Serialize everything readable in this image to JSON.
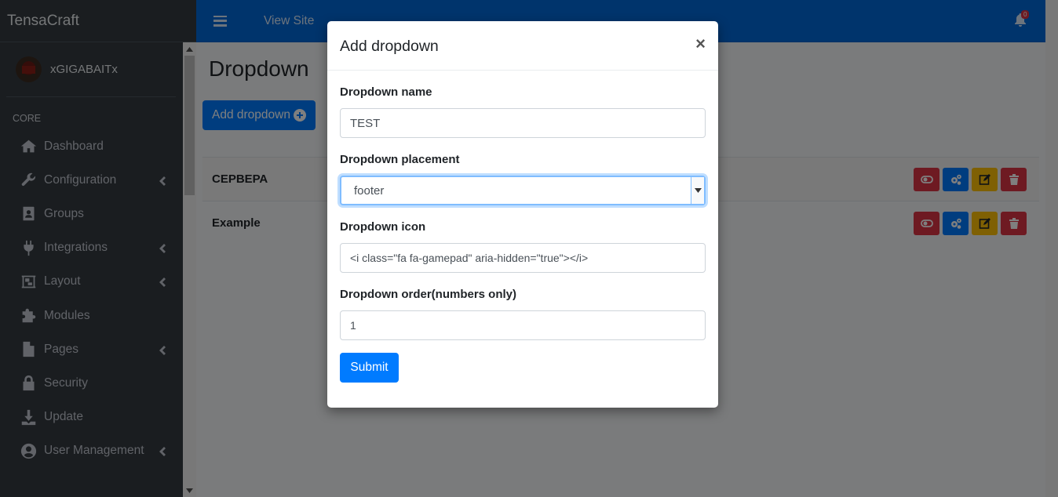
{
  "sidebar": {
    "brand": "TensaCraft",
    "user_name": "xGIGABAITx",
    "nav_header": "CORE",
    "items": [
      {
        "label": "Dashboard"
      },
      {
        "label": "Configuration"
      },
      {
        "label": "Groups"
      },
      {
        "label": "Integrations"
      },
      {
        "label": "Layout"
      },
      {
        "label": "Modules"
      },
      {
        "label": "Pages"
      },
      {
        "label": "Security"
      },
      {
        "label": "Update"
      },
      {
        "label": "User Management"
      }
    ]
  },
  "topnav": {
    "view_site": "View Site",
    "notification_count": "0"
  },
  "main": {
    "title": "Dropdown",
    "add_button": "Add dropdown",
    "rows": [
      {
        "name": "СЕРВЕРА"
      },
      {
        "name": "Example"
      }
    ]
  },
  "modal": {
    "title": "Add dropdown",
    "close": "×",
    "name_label": "Dropdown name",
    "name_value": "TEST",
    "placement_label": "Dropdown placement",
    "placement_value": "footer",
    "icon_label": "Dropdown icon",
    "icon_value": "<i class=\"fa fa-gamepad\" aria-hidden=\"true\"></i>",
    "order_label": "Dropdown order(numbers only)",
    "order_value": "1",
    "submit": "Submit"
  },
  "colors": {
    "primary": "#007bff",
    "navbar": "#0069d9",
    "sidebar": "#343a40",
    "danger": "#dc3545",
    "warning": "#ffc107"
  }
}
